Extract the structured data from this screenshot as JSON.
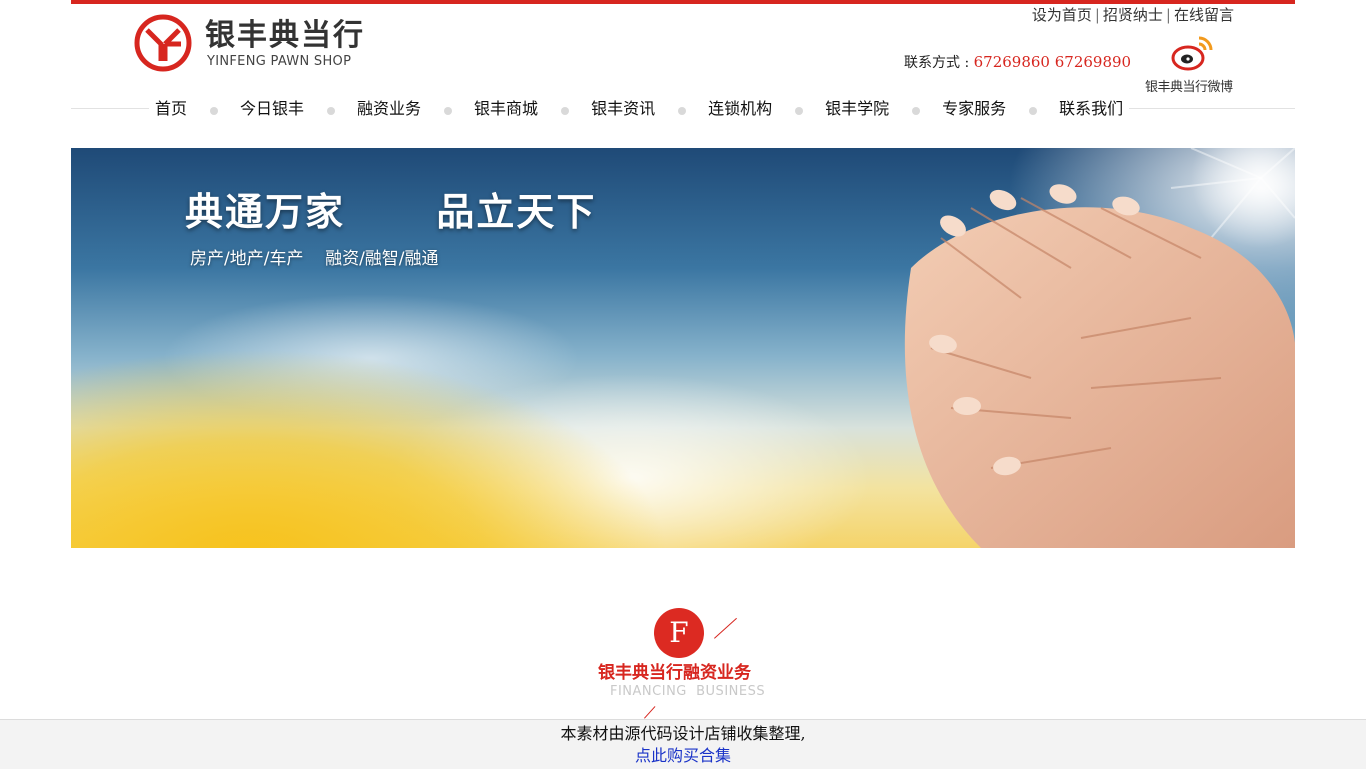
{
  "header": {
    "logo_cn": "银丰典当行",
    "logo_en": "YINFENG PAWN SHOP",
    "top_links": [
      "设为首页",
      "招贤纳士",
      "在线留言"
    ],
    "contact_label": "联系方式 : ",
    "contact_phones": "67269860 67269890",
    "weibo_label": "银丰典当行微博"
  },
  "nav": {
    "items": [
      "首页",
      "今日银丰",
      "融资业务",
      "银丰商城",
      "银丰资讯",
      "连锁机构",
      "银丰学院",
      "专家服务",
      "联系我们"
    ]
  },
  "banner": {
    "title": "典通万家      品立天下",
    "subtitle": "房产/地产/车产    融资/融智/融通"
  },
  "section": {
    "icon_letter": "F",
    "title_cn": "银丰典当行融资业务",
    "title_en": "FINANCING  BUSINESS"
  },
  "footer": {
    "text": "本素材由源代码设计店铺收集整理,",
    "link": "点此购买合集"
  },
  "colors": {
    "accent_red": "#d7261f",
    "link_blue": "#1a33c8"
  }
}
